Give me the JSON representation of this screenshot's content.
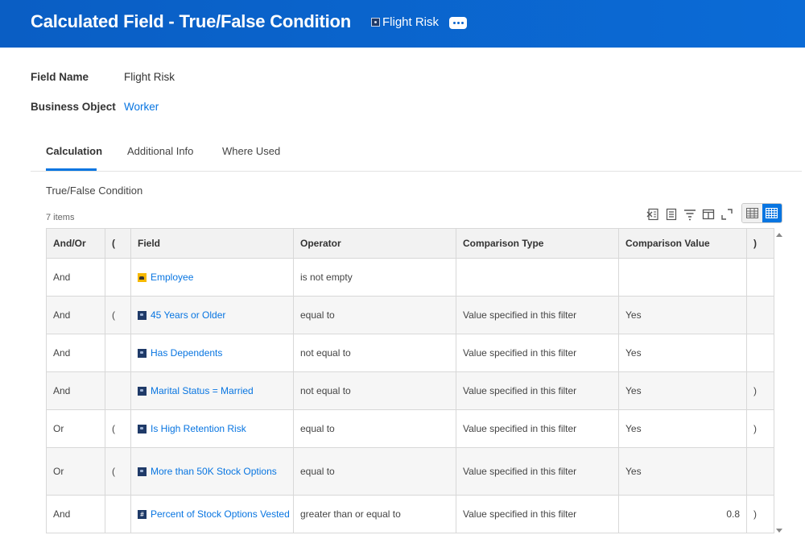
{
  "header": {
    "title": "Calculated Field - True/False Condition",
    "object_name": "Flight Risk",
    "object_icon": "related-actions-icon",
    "more_icon": "ellipsis-icon",
    "color": "#0b66cf"
  },
  "fields": {
    "field_name_label": "Field Name",
    "field_name_value": "Flight Risk",
    "business_object_label": "Business Object",
    "business_object_value": "Worker"
  },
  "tabs": [
    {
      "label": "Calculation",
      "active": true
    },
    {
      "label": "Additional Info",
      "active": false
    },
    {
      "label": "Where Used",
      "active": false
    }
  ],
  "section": {
    "title": "True/False Condition",
    "items_count": "7 items"
  },
  "toolbar": {
    "icons": [
      "excel-export-icon",
      "pdf-export-icon",
      "filter-icon",
      "column-layout-icon",
      "fullscreen-icon"
    ],
    "view_toggle": [
      "table-view-icon",
      "grid-view-icon"
    ]
  },
  "grid": {
    "columns": [
      "And/Or",
      "(",
      "Field",
      "Operator",
      "Comparison Type",
      "Comparison Value",
      ")"
    ],
    "rows": [
      {
        "andor": "And",
        "open": "",
        "field": "Employee",
        "field_icon": "instance-icon",
        "operator": "is not empty",
        "ctype": "",
        "cvalue": "",
        "close": ""
      },
      {
        "andor": "And",
        "open": "(",
        "field": "45 Years or Older",
        "field_icon": "calculated-field-icon",
        "operator": "equal to",
        "ctype": "Value specified in this filter",
        "cvalue": "Yes",
        "close": ""
      },
      {
        "andor": "And",
        "open": "",
        "field": "Has Dependents",
        "field_icon": "calculated-field-icon",
        "operator": "not equal to",
        "ctype": "Value specified in this filter",
        "cvalue": "Yes",
        "close": ""
      },
      {
        "andor": "And",
        "open": "",
        "field": "Marital Status = Married",
        "field_icon": "calculated-field-icon",
        "operator": "not equal to",
        "ctype": "Value specified in this filter",
        "cvalue": "Yes",
        "close": ")"
      },
      {
        "andor": "Or",
        "open": "(",
        "field": "Is High Retention Risk",
        "field_icon": "calculated-field-icon",
        "operator": "equal to",
        "ctype": "Value specified in this filter",
        "cvalue": "Yes",
        "close": ")"
      },
      {
        "andor": "Or",
        "open": "(",
        "field": "More than 50K Stock Options",
        "field_icon": "calculated-field-icon",
        "operator": "equal to",
        "ctype": "Value specified in this filter",
        "cvalue": "Yes",
        "close": ""
      },
      {
        "andor": "And",
        "open": "",
        "field": "Percent of Stock Options Vested",
        "field_icon": "numeric-field-icon",
        "operator": "greater than or equal to",
        "ctype": "Value specified in this filter",
        "cvalue": "0.8",
        "close": ")"
      }
    ]
  }
}
